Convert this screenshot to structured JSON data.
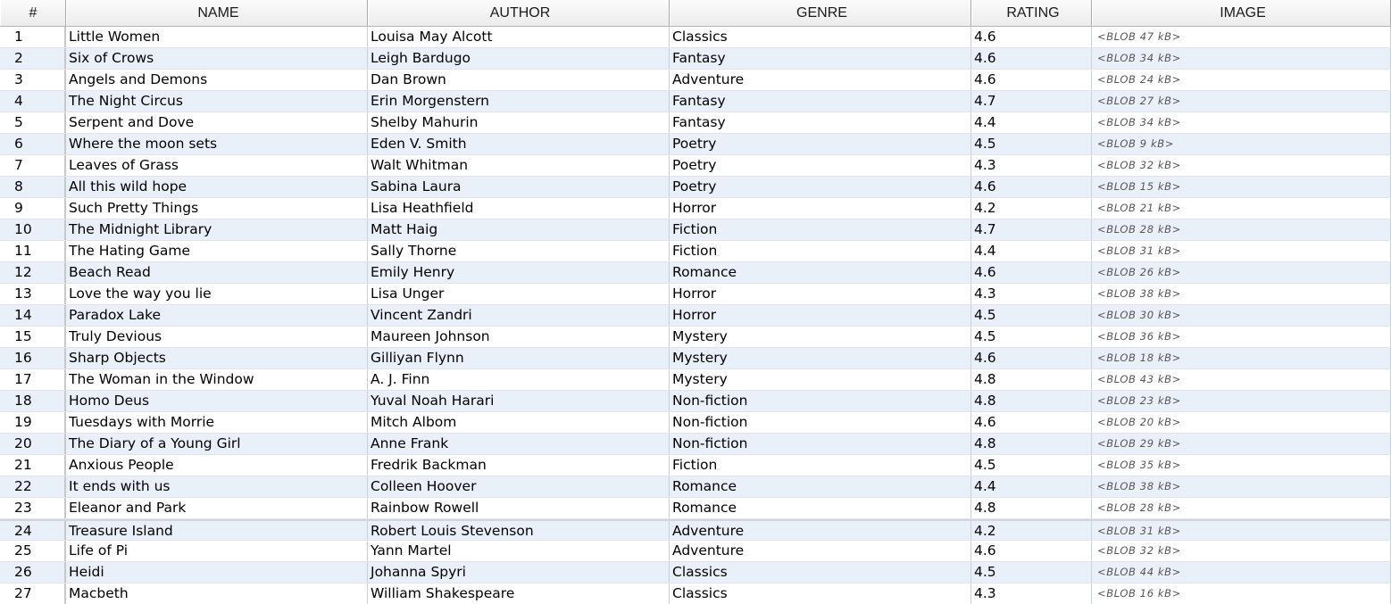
{
  "table": {
    "columns": [
      "#",
      "NAME",
      "AUTHOR",
      "GENRE",
      "RATING",
      "IMAGE"
    ],
    "rows": [
      {
        "num": "1",
        "name": "Little Women",
        "author": "Louisa May Alcott",
        "genre": "Classics",
        "rating": "4.6",
        "image": "<BLOB 47 kB>"
      },
      {
        "num": "2",
        "name": "Six of Crows",
        "author": "Leigh Bardugo",
        "genre": "Fantasy",
        "rating": "4.6",
        "image": "<BLOB 34 kB>"
      },
      {
        "num": "3",
        "name": "Angels and Demons",
        "author": "Dan Brown",
        "genre": "Adventure",
        "rating": "4.6",
        "image": "<BLOB 24 kB>"
      },
      {
        "num": "4",
        "name": "The Night Circus",
        "author": "Erin Morgenstern",
        "genre": "Fantasy",
        "rating": "4.7",
        "image": "<BLOB 27 kB>"
      },
      {
        "num": "5",
        "name": "Serpent and Dove",
        "author": "Shelby Mahurin",
        "genre": "Fantasy",
        "rating": "4.4",
        "image": "<BLOB 34 kB>"
      },
      {
        "num": "6",
        "name": "Where the moon sets",
        "author": "Eden V. Smith",
        "genre": "Poetry",
        "rating": "4.5",
        "image": "<BLOB 9 kB>"
      },
      {
        "num": "7",
        "name": "Leaves of Grass",
        "author": "Walt Whitman",
        "genre": "Poetry",
        "rating": "4.3",
        "image": "<BLOB 32 kB>"
      },
      {
        "num": "8",
        "name": "All this wild hope",
        "author": "Sabina Laura",
        "genre": "Poetry",
        "rating": "4.6",
        "image": "<BLOB 15 kB>"
      },
      {
        "num": "9",
        "name": "Such Pretty Things",
        "author": "Lisa Heathfield",
        "genre": "Horror",
        "rating": "4.2",
        "image": "<BLOB 21 kB>"
      },
      {
        "num": "10",
        "name": "The Midnight Library",
        "author": "Matt Haig",
        "genre": "Fiction",
        "rating": "4.7",
        "image": "<BLOB 28 kB>"
      },
      {
        "num": "11",
        "name": "The Hating Game",
        "author": "Sally Thorne",
        "genre": "Fiction",
        "rating": "4.4",
        "image": "<BLOB 31 kB>"
      },
      {
        "num": "12",
        "name": "Beach Read",
        "author": "Emily Henry",
        "genre": "Romance",
        "rating": "4.6",
        "image": "<BLOB 26 kB>"
      },
      {
        "num": "13",
        "name": "Love the way you lie",
        "author": "Lisa Unger",
        "genre": "Horror",
        "rating": "4.3",
        "image": "<BLOB 38 kB>"
      },
      {
        "num": "14",
        "name": "Paradox Lake",
        "author": "Vincent Zandri",
        "genre": "Horror",
        "rating": "4.5",
        "image": "<BLOB 30 kB>"
      },
      {
        "num": "15",
        "name": "Truly Devious",
        "author": "Maureen Johnson",
        "genre": "Mystery",
        "rating": "4.5",
        "image": "<BLOB 36 kB>"
      },
      {
        "num": "16",
        "name": "Sharp Objects",
        "author": "Gilliyan Flynn",
        "genre": "Mystery",
        "rating": "4.6",
        "image": "<BLOB 18 kB>"
      },
      {
        "num": "17",
        "name": "The Woman in the Window",
        "author": "A. J. Finn",
        "genre": "Mystery",
        "rating": "4.8",
        "image": "<BLOB 43 kB>"
      },
      {
        "num": "18",
        "name": "Homo Deus",
        "author": "Yuval Noah Harari",
        "genre": "Non-fiction",
        "rating": "4.8",
        "image": "<BLOB 23 kB>"
      },
      {
        "num": "19",
        "name": "Tuesdays with Morrie",
        "author": "Mitch Albom",
        "genre": "Non-fiction",
        "rating": "4.6",
        "image": "<BLOB 20 kB>"
      },
      {
        "num": "20",
        "name": "The Diary of a Young Girl",
        "author": "Anne Frank",
        "genre": "Non-fiction",
        "rating": "4.8",
        "image": "<BLOB 29 kB>"
      },
      {
        "num": "21",
        "name": "Anxious People",
        "author": "Fredrik Backman",
        "genre": "Fiction",
        "rating": "4.5",
        "image": "<BLOB 35 kB>"
      },
      {
        "num": "22",
        "name": "It ends with us",
        "author": "Colleen Hoover",
        "genre": "Romance",
        "rating": "4.4",
        "image": "<BLOB 38 kB>"
      },
      {
        "num": "23",
        "name": "Eleanor and Park",
        "author": "Rainbow Rowell",
        "genre": "Romance",
        "rating": "4.8",
        "image": "<BLOB 28 kB>"
      },
      {
        "num": "24",
        "name": "Treasure Island",
        "author": "Robert Louis Stevenson",
        "genre": "Adventure",
        "rating": "4.2",
        "image": "<BLOB 31 kB>"
      },
      {
        "num": "25",
        "name": "Life of Pi",
        "author": "Yann Martel",
        "genre": "Adventure",
        "rating": "4.6",
        "image": "<BLOB 32 kB>"
      },
      {
        "num": "26",
        "name": "Heidi",
        "author": "Johanna Spyri",
        "genre": "Classics",
        "rating": "4.5",
        "image": "<BLOB 44 kB>"
      },
      {
        "num": "27",
        "name": "Macbeth",
        "author": "William Shakespeare",
        "genre": "Classics",
        "rating": "4.3",
        "image": "<BLOB 16 kB>"
      }
    ]
  },
  "colors": {
    "alt_row": "#e9f0f9",
    "grid_line": "#c8d0d8"
  }
}
